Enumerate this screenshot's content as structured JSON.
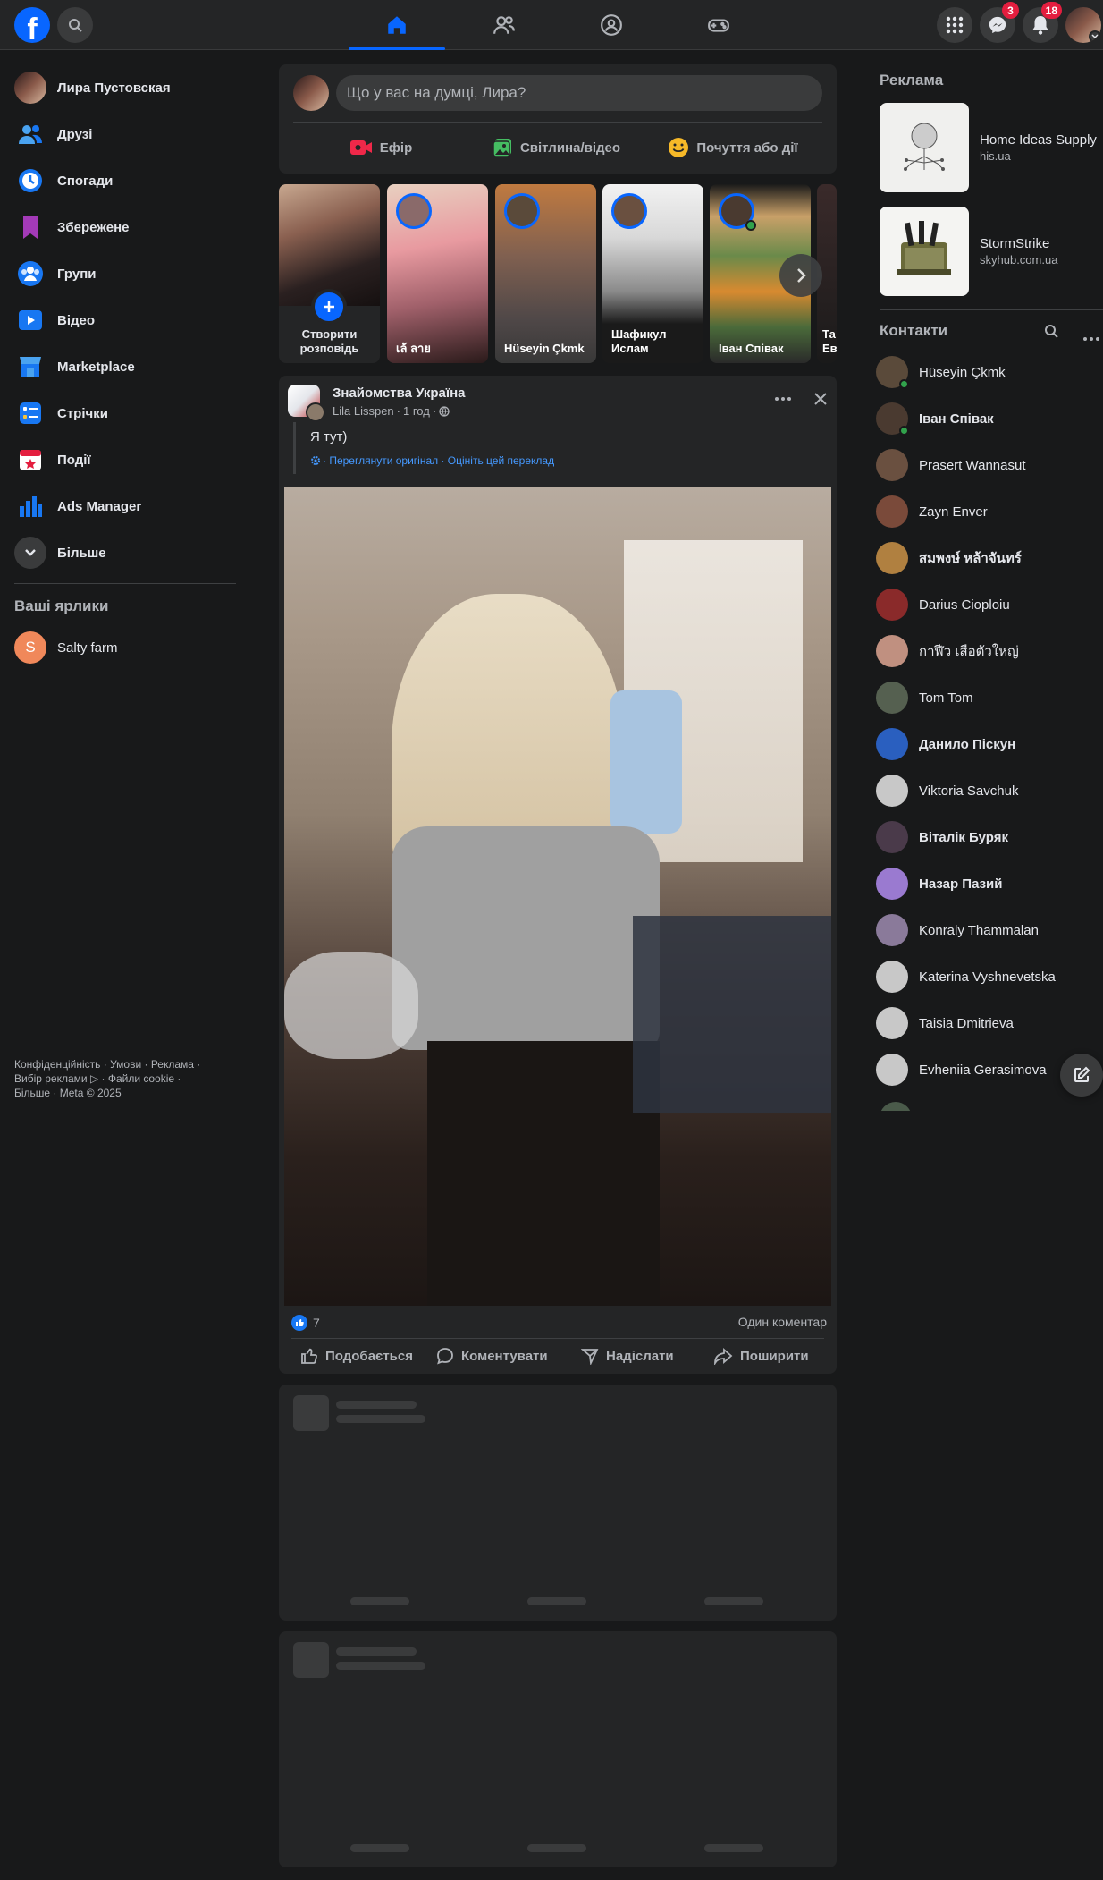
{
  "topbar": {
    "logo_letter": "f",
    "messenger_badge": "3",
    "notifications_badge": "18"
  },
  "left_nav": {
    "profile_name": "Лира Пустовская",
    "items": [
      {
        "label": "Друзі",
        "icon": "friends-icon"
      },
      {
        "label": "Спогади",
        "icon": "memories-clock-icon"
      },
      {
        "label": "Збережене",
        "icon": "saved-bookmark-icon"
      },
      {
        "label": "Групи",
        "icon": "groups-icon"
      },
      {
        "label": "Відео",
        "icon": "video-icon"
      },
      {
        "label": "Marketplace",
        "icon": "marketplace-icon"
      },
      {
        "label": "Стрічки",
        "icon": "feeds-icon"
      },
      {
        "label": "Події",
        "icon": "events-calendar-icon"
      },
      {
        "label": "Ads Manager",
        "icon": "ads-manager-chart-icon"
      },
      {
        "label": "Більше",
        "icon": "chevron-down-icon"
      }
    ],
    "shortcuts_title": "Ваші ярлики",
    "shortcuts": [
      {
        "label": "Salty farm",
        "initial": "S"
      }
    ],
    "footer_line1": "Конфіденційність · Умови · Реклама ·",
    "footer_line2": "Вибір реклами ▷ · Файли cookie ·",
    "footer_line3": "Більше · Meta © 2025"
  },
  "composer": {
    "placeholder": "Що у вас на думці, Лира?",
    "live_label": "Ефір",
    "photo_label": "Світлина/відео",
    "feeling_label": "Почуття або дії"
  },
  "stories": [
    {
      "name": "Створити розповідь"
    },
    {
      "name": "เล้ ลาย"
    },
    {
      "name": "Hüseyin Çkmk"
    },
    {
      "name": "Шафикул Ислам"
    },
    {
      "name": "Іван Співак"
    },
    {
      "name": "Та Ев"
    }
  ],
  "post": {
    "group_name": "Знайомства Україна",
    "author": "Lila Lisspen",
    "time": "1 год",
    "text": "Я тут)",
    "translation_links": "· Переглянути оригінал · Оцініть цей переклад",
    "likes_count": "7",
    "comments_count": "Один коментар",
    "like_label": "Подобається",
    "comment_label": "Коментувати",
    "send_label": "Надіслати",
    "share_label": "Поширити"
  },
  "ads": {
    "title": "Реклама",
    "items": [
      {
        "name": "Home Ideas Supply",
        "domain": "his.ua"
      },
      {
        "name": "StormStrike",
        "domain": "skyhub.com.ua"
      }
    ]
  },
  "contacts": {
    "title": "Контакти",
    "items": [
      {
        "name": "Hüseyin Çkmk",
        "online": true,
        "bold": false,
        "color": "#5a4a3a"
      },
      {
        "name": "Іван Співак",
        "online": true,
        "bold": true,
        "color": "#4a3a30"
      },
      {
        "name": "Prasert Wannasut",
        "online": false,
        "bold": false,
        "color": "#6a5040"
      },
      {
        "name": "Zayn Enver",
        "online": false,
        "bold": false,
        "color": "#7a4a3a"
      },
      {
        "name": "สมพงษ์ หล้าจันทร์",
        "online": false,
        "bold": true,
        "color": "#b08040"
      },
      {
        "name": "Darius Cioploiu",
        "online": false,
        "bold": false,
        "color": "#8a2a2a"
      },
      {
        "name": "กาฬีว เสือตัวใหญ่",
        "online": false,
        "bold": false,
        "color": "#c09080"
      },
      {
        "name": "Tom Tom",
        "online": false,
        "bold": false,
        "color": "#556050"
      },
      {
        "name": "Данило Піскун",
        "online": false,
        "bold": true,
        "color": "#2a5fbf"
      },
      {
        "name": "Viktoria Savchuk",
        "online": false,
        "bold": false,
        "color": "#c8c8c8"
      },
      {
        "name": "Віталік Буряк",
        "online": false,
        "bold": true,
        "color": "#4a3a4a"
      },
      {
        "name": "Назар Пазий",
        "online": false,
        "bold": true,
        "color": "#9a7ad0"
      },
      {
        "name": "Konraly Thammalan",
        "online": false,
        "bold": false,
        "color": "#8a7a9a"
      },
      {
        "name": "Katerina Vyshnevetska",
        "online": false,
        "bold": false,
        "color": "#c8c8c8"
      },
      {
        "name": "Taisia Dmitrieva",
        "online": false,
        "bold": false,
        "color": "#c8c8c8"
      },
      {
        "name": "Evheniia Gerasimova",
        "online": false,
        "bold": false,
        "color": "#c8c8c8"
      }
    ]
  }
}
